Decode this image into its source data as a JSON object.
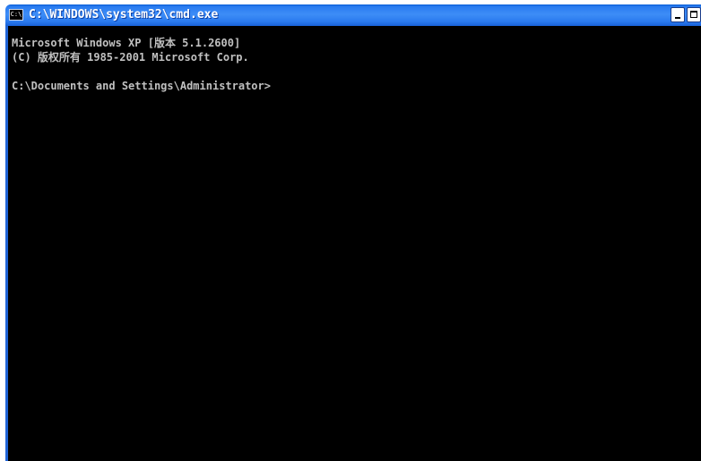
{
  "window": {
    "title": "C:\\WINDOWS\\system32\\cmd.exe",
    "icon_label": "C:\\"
  },
  "console": {
    "lines": [
      "Microsoft Windows XP [版本 5.1.2600]",
      "(C) 版权所有 1985-2001 Microsoft Corp.",
      "",
      "C:\\Documents and Settings\\Administrator>"
    ]
  }
}
